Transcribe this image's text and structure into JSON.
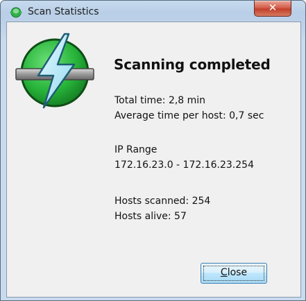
{
  "window": {
    "title": "Scan Statistics",
    "close_glyph": "✕"
  },
  "icons": {
    "app": "ipscan-icon",
    "logo": "lightning-logo-icon"
  },
  "content": {
    "heading": "Scanning completed",
    "total_time": "Total time: 2,8 min",
    "avg_time": "Average time per host: 0,7 sec",
    "ip_range_label": "IP Range",
    "ip_range_value": "172.16.23.0 - 172.16.23.254",
    "hosts_scanned": "Hosts scanned: 254",
    "hosts_alive": "Hosts alive: 57"
  },
  "buttons": {
    "close_label_first": "C",
    "close_label_rest": "lose"
  },
  "colors": {
    "logo_green": "#27b43a",
    "logo_bolt": "#a8e6f5"
  }
}
